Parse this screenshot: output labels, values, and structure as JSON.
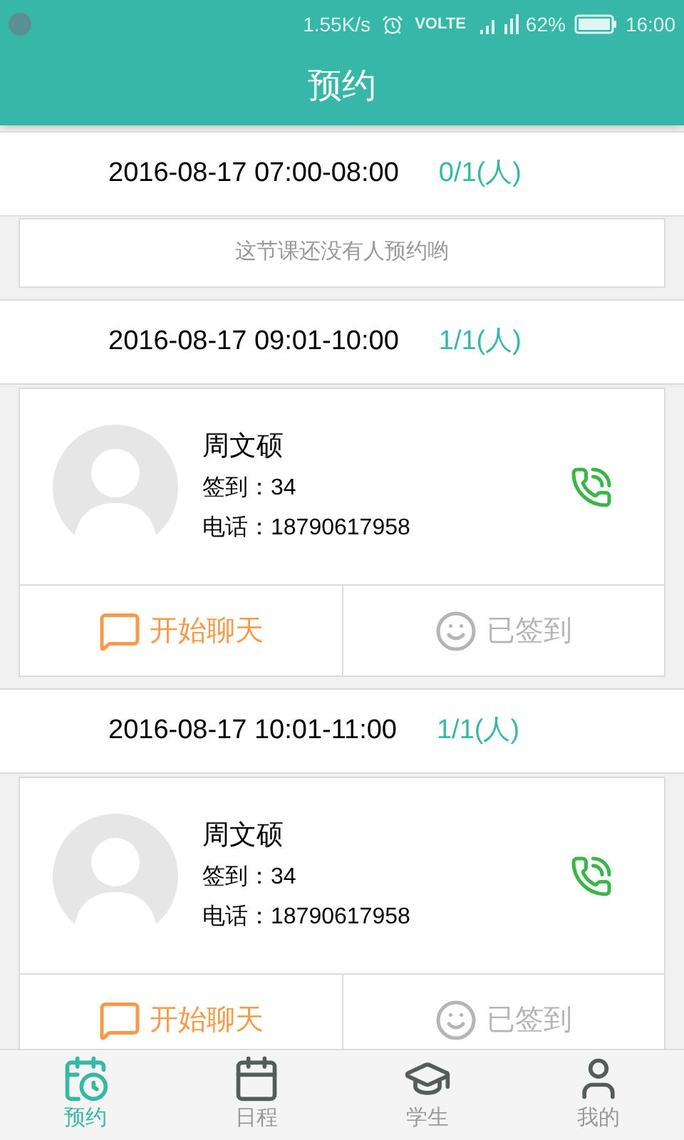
{
  "status_bar": {
    "speed": "1.55K/s",
    "network": "VOLTE",
    "battery": "62%",
    "time": "16:00"
  },
  "title": "预约",
  "slots": [
    {
      "time": "2016-08-17 07:00-08:00",
      "count": "0/1(人)",
      "empty_message": "这节课还没有人预约哟"
    },
    {
      "time": "2016-08-17 09:01-10:00",
      "count": "1/1(人)",
      "bookings": [
        {
          "name": "周文硕",
          "checkin": "签到：34",
          "phone": "电话：18790617958",
          "chat_label": "开始聊天",
          "signed_label": "已签到",
          "signed": true
        }
      ]
    },
    {
      "time": "2016-08-17 10:01-11:00",
      "count": "1/1(人)",
      "bookings": [
        {
          "name": "周文硕",
          "checkin": "签到：34",
          "phone": "电话：18790617958",
          "chat_label": "开始聊天",
          "signed_label": "已签到",
          "signed": true
        }
      ]
    }
  ],
  "nav": [
    {
      "label": "预约",
      "kind": "booking",
      "selected": true
    },
    {
      "label": "日程",
      "kind": "schedule",
      "selected": false
    },
    {
      "label": "学生",
      "kind": "student",
      "selected": false
    },
    {
      "label": "我的",
      "kind": "me",
      "selected": false
    }
  ]
}
